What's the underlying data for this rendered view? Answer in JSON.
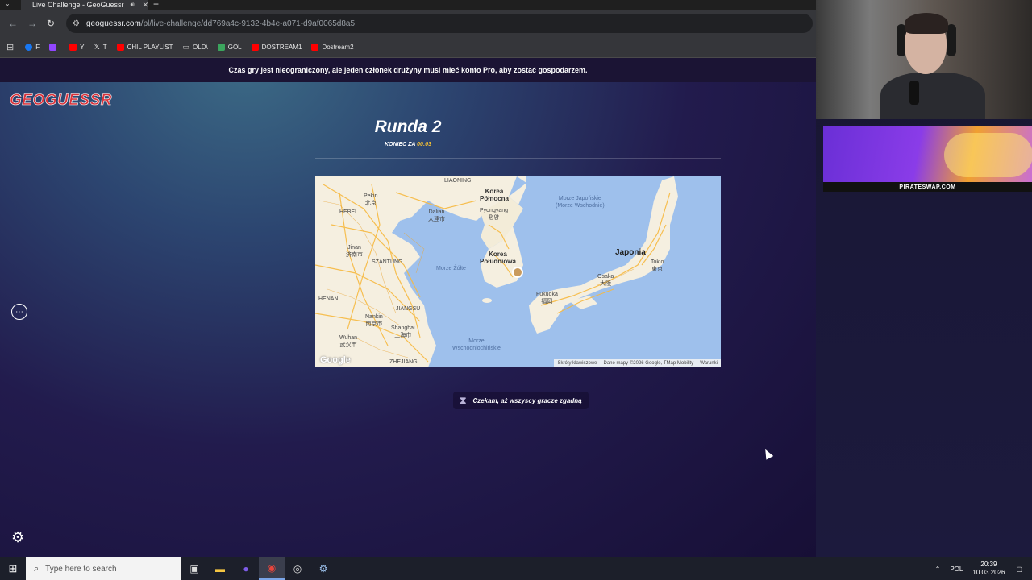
{
  "browser": {
    "tab_title": "Live Challenge - GeoGuessr",
    "url_host": "geoguessr.com",
    "url_path": "/pl/live-challenge/dd769a4c-9132-4b4e-a071-d9af0065d8a5",
    "bookmarks": [
      {
        "label": "F",
        "color": "#1877f2"
      },
      {
        "label": "",
        "color": "#9146ff"
      },
      {
        "label": "Y",
        "color": "#ff0000"
      },
      {
        "label": "T",
        "color": "#000000"
      },
      {
        "label": "CHIL PLAYLIST",
        "color": "#ff0000"
      },
      {
        "label": "OLD\\",
        "color": "#cccccc"
      },
      {
        "label": "GOL",
        "color": "#3ba55d"
      },
      {
        "label": "DOSTREAM1",
        "color": "#ff0000"
      },
      {
        "label": "Dostream2",
        "color": "#ff0000"
      }
    ]
  },
  "game": {
    "banner": "Czas gry jest nieograniczony, ale jeden członek drużyny musi mieć konto Pro, aby zostać gospodarzem.",
    "logo": "GEOGUESSR",
    "round_title": "Runda 2",
    "timer_label": "KONIEC ZA",
    "timer_value": "00:03",
    "waiting_text": "Czekam, aż wszyscy gracze zgadną"
  },
  "map": {
    "labels": {
      "liaoning": "LIAONING",
      "korea_n": "Korea\nPółnocna",
      "morze_jap": "Morze Japońskie\n(Morze Wschodnie)",
      "pekin": "Pekin\n北京",
      "hebei": "HEBEI",
      "dalian": "Dalian\n大連市",
      "pyongyang": "Pyongyang\n평양",
      "japonia": "Japonia",
      "jinan": "Jinan\n济南市",
      "szantung": "SZANTUNG",
      "morze_zolte": "Morze Żółte",
      "korea_s": "Korea\nPołudniowa",
      "tokio": "Tokio\n東京",
      "osaka": "Osaka\n大阪",
      "henan": "HENAN",
      "fukuoka": "Fukuoka\n福岡",
      "jiangsu": "JIANGSU",
      "nankin": "Nankin\n南京市",
      "shanghai": "Shanghai\n上海市",
      "wuhan": "Wuhan\n武汉市",
      "morze_wsch": "Morze\nWschodniochińskie",
      "zhejiang": "ZHEJIANG"
    },
    "google": "Google",
    "footer": [
      "Skróty klawiszowe",
      "Dane mapy ©2026 Google, TMap Mobility",
      "Warunki"
    ]
  },
  "ad": {
    "text": "PIRATESWAP.COM"
  },
  "taskbar": {
    "search_placeholder": "Type here to search",
    "lang": "POL",
    "time": "20:39",
    "date": "10.03.2026"
  }
}
